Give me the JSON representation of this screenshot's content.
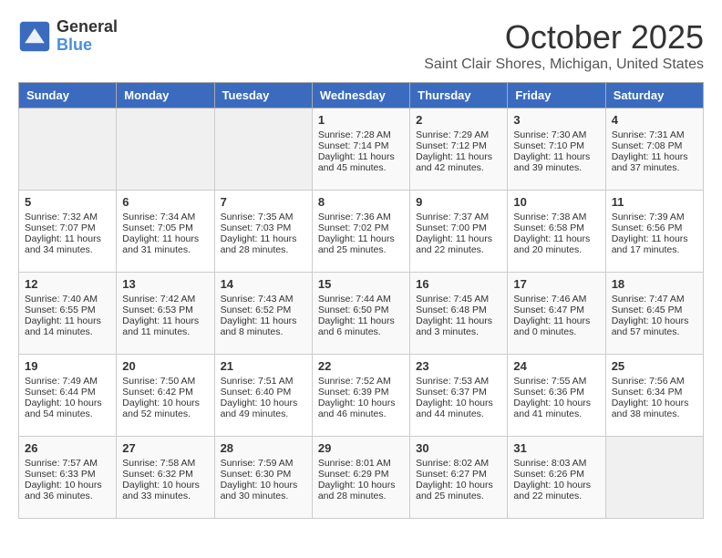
{
  "header": {
    "logo_general": "General",
    "logo_blue": "Blue",
    "month": "October 2025",
    "location": "Saint Clair Shores, Michigan, United States"
  },
  "weekdays": [
    "Sunday",
    "Monday",
    "Tuesday",
    "Wednesday",
    "Thursday",
    "Friday",
    "Saturday"
  ],
  "weeks": [
    [
      {
        "day": "",
        "sunrise": "",
        "sunset": "",
        "daylight": ""
      },
      {
        "day": "",
        "sunrise": "",
        "sunset": "",
        "daylight": ""
      },
      {
        "day": "",
        "sunrise": "",
        "sunset": "",
        "daylight": ""
      },
      {
        "day": "1",
        "sunrise": "Sunrise: 7:28 AM",
        "sunset": "Sunset: 7:14 PM",
        "daylight": "Daylight: 11 hours and 45 minutes."
      },
      {
        "day": "2",
        "sunrise": "Sunrise: 7:29 AM",
        "sunset": "Sunset: 7:12 PM",
        "daylight": "Daylight: 11 hours and 42 minutes."
      },
      {
        "day": "3",
        "sunrise": "Sunrise: 7:30 AM",
        "sunset": "Sunset: 7:10 PM",
        "daylight": "Daylight: 11 hours and 39 minutes."
      },
      {
        "day": "4",
        "sunrise": "Sunrise: 7:31 AM",
        "sunset": "Sunset: 7:08 PM",
        "daylight": "Daylight: 11 hours and 37 minutes."
      }
    ],
    [
      {
        "day": "5",
        "sunrise": "Sunrise: 7:32 AM",
        "sunset": "Sunset: 7:07 PM",
        "daylight": "Daylight: 11 hours and 34 minutes."
      },
      {
        "day": "6",
        "sunrise": "Sunrise: 7:34 AM",
        "sunset": "Sunset: 7:05 PM",
        "daylight": "Daylight: 11 hours and 31 minutes."
      },
      {
        "day": "7",
        "sunrise": "Sunrise: 7:35 AM",
        "sunset": "Sunset: 7:03 PM",
        "daylight": "Daylight: 11 hours and 28 minutes."
      },
      {
        "day": "8",
        "sunrise": "Sunrise: 7:36 AM",
        "sunset": "Sunset: 7:02 PM",
        "daylight": "Daylight: 11 hours and 25 minutes."
      },
      {
        "day": "9",
        "sunrise": "Sunrise: 7:37 AM",
        "sunset": "Sunset: 7:00 PM",
        "daylight": "Daylight: 11 hours and 22 minutes."
      },
      {
        "day": "10",
        "sunrise": "Sunrise: 7:38 AM",
        "sunset": "Sunset: 6:58 PM",
        "daylight": "Daylight: 11 hours and 20 minutes."
      },
      {
        "day": "11",
        "sunrise": "Sunrise: 7:39 AM",
        "sunset": "Sunset: 6:56 PM",
        "daylight": "Daylight: 11 hours and 17 minutes."
      }
    ],
    [
      {
        "day": "12",
        "sunrise": "Sunrise: 7:40 AM",
        "sunset": "Sunset: 6:55 PM",
        "daylight": "Daylight: 11 hours and 14 minutes."
      },
      {
        "day": "13",
        "sunrise": "Sunrise: 7:42 AM",
        "sunset": "Sunset: 6:53 PM",
        "daylight": "Daylight: 11 hours and 11 minutes."
      },
      {
        "day": "14",
        "sunrise": "Sunrise: 7:43 AM",
        "sunset": "Sunset: 6:52 PM",
        "daylight": "Daylight: 11 hours and 8 minutes."
      },
      {
        "day": "15",
        "sunrise": "Sunrise: 7:44 AM",
        "sunset": "Sunset: 6:50 PM",
        "daylight": "Daylight: 11 hours and 6 minutes."
      },
      {
        "day": "16",
        "sunrise": "Sunrise: 7:45 AM",
        "sunset": "Sunset: 6:48 PM",
        "daylight": "Daylight: 11 hours and 3 minutes."
      },
      {
        "day": "17",
        "sunrise": "Sunrise: 7:46 AM",
        "sunset": "Sunset: 6:47 PM",
        "daylight": "Daylight: 11 hours and 0 minutes."
      },
      {
        "day": "18",
        "sunrise": "Sunrise: 7:47 AM",
        "sunset": "Sunset: 6:45 PM",
        "daylight": "Daylight: 10 hours and 57 minutes."
      }
    ],
    [
      {
        "day": "19",
        "sunrise": "Sunrise: 7:49 AM",
        "sunset": "Sunset: 6:44 PM",
        "daylight": "Daylight: 10 hours and 54 minutes."
      },
      {
        "day": "20",
        "sunrise": "Sunrise: 7:50 AM",
        "sunset": "Sunset: 6:42 PM",
        "daylight": "Daylight: 10 hours and 52 minutes."
      },
      {
        "day": "21",
        "sunrise": "Sunrise: 7:51 AM",
        "sunset": "Sunset: 6:40 PM",
        "daylight": "Daylight: 10 hours and 49 minutes."
      },
      {
        "day": "22",
        "sunrise": "Sunrise: 7:52 AM",
        "sunset": "Sunset: 6:39 PM",
        "daylight": "Daylight: 10 hours and 46 minutes."
      },
      {
        "day": "23",
        "sunrise": "Sunrise: 7:53 AM",
        "sunset": "Sunset: 6:37 PM",
        "daylight": "Daylight: 10 hours and 44 minutes."
      },
      {
        "day": "24",
        "sunrise": "Sunrise: 7:55 AM",
        "sunset": "Sunset: 6:36 PM",
        "daylight": "Daylight: 10 hours and 41 minutes."
      },
      {
        "day": "25",
        "sunrise": "Sunrise: 7:56 AM",
        "sunset": "Sunset: 6:34 PM",
        "daylight": "Daylight: 10 hours and 38 minutes."
      }
    ],
    [
      {
        "day": "26",
        "sunrise": "Sunrise: 7:57 AM",
        "sunset": "Sunset: 6:33 PM",
        "daylight": "Daylight: 10 hours and 36 minutes."
      },
      {
        "day": "27",
        "sunrise": "Sunrise: 7:58 AM",
        "sunset": "Sunset: 6:32 PM",
        "daylight": "Daylight: 10 hours and 33 minutes."
      },
      {
        "day": "28",
        "sunrise": "Sunrise: 7:59 AM",
        "sunset": "Sunset: 6:30 PM",
        "daylight": "Daylight: 10 hours and 30 minutes."
      },
      {
        "day": "29",
        "sunrise": "Sunrise: 8:01 AM",
        "sunset": "Sunset: 6:29 PM",
        "daylight": "Daylight: 10 hours and 28 minutes."
      },
      {
        "day": "30",
        "sunrise": "Sunrise: 8:02 AM",
        "sunset": "Sunset: 6:27 PM",
        "daylight": "Daylight: 10 hours and 25 minutes."
      },
      {
        "day": "31",
        "sunrise": "Sunrise: 8:03 AM",
        "sunset": "Sunset: 6:26 PM",
        "daylight": "Daylight: 10 hours and 22 minutes."
      },
      {
        "day": "",
        "sunrise": "",
        "sunset": "",
        "daylight": ""
      }
    ]
  ]
}
